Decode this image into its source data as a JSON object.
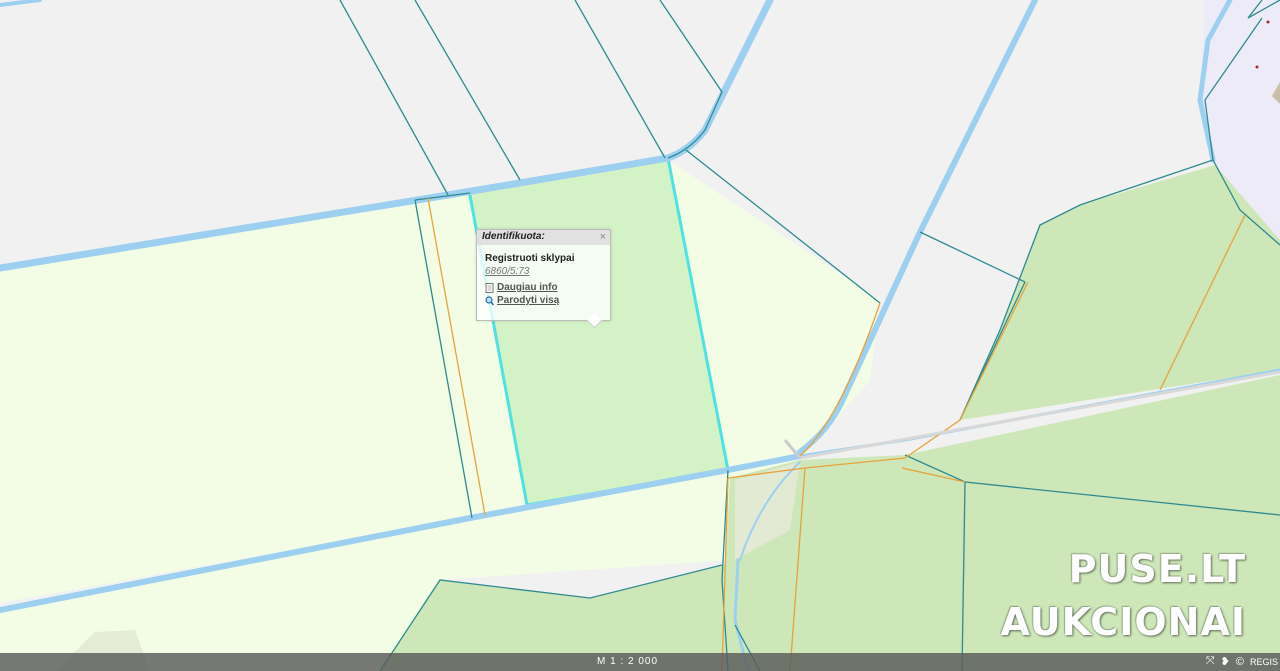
{
  "popup": {
    "header": "Identifikuota:",
    "close_symbol": "×",
    "layer_title": "Registruoti sklypai",
    "parcel_id": "6860/5:73",
    "more_info": "Daugiau info",
    "show_all": "Parodyti visą"
  },
  "watermark": {
    "line1": "PUSE.LT",
    "line2": "AUKCIONAI"
  },
  "status_bar": {
    "scale": "M 1 : 2 000",
    "icons": [
      "fullscreen-icon",
      "pin-icon",
      "copyright-icon"
    ],
    "registry_text": "REGIS"
  },
  "colors": {
    "background": "#f1f1f1",
    "field": "#f3fde6",
    "forest": "#cde7b9",
    "selected_parcel": "#d3f2c6",
    "selected_outline": "#4de3e3",
    "water": "#9dd0f0",
    "parcel_line": "#2e8a90",
    "road_line": "#e8a23a"
  }
}
